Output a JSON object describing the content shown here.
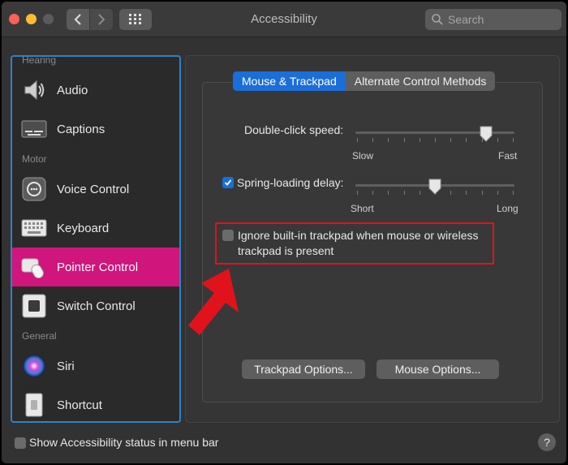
{
  "window": {
    "title": "Accessibility"
  },
  "search": {
    "placeholder": "Search"
  },
  "sidebar": {
    "sections": {
      "hearing": "Hearing",
      "motor": "Motor",
      "general": "General"
    },
    "items": [
      {
        "label": "Audio",
        "icon": "speaker-icon"
      },
      {
        "label": "Captions",
        "icon": "captions-icon"
      },
      {
        "label": "Voice Control",
        "icon": "voice-control-icon"
      },
      {
        "label": "Keyboard",
        "icon": "keyboard-icon"
      },
      {
        "label": "Pointer Control",
        "icon": "pointer-control-icon",
        "selected": true
      },
      {
        "label": "Switch Control",
        "icon": "switch-control-icon"
      },
      {
        "label": "Siri",
        "icon": "siri-icon"
      },
      {
        "label": "Shortcut",
        "icon": "shortcut-icon"
      }
    ]
  },
  "tabs": [
    {
      "label": "Mouse & Trackpad",
      "active": true
    },
    {
      "label": "Alternate Control Methods",
      "active": false
    }
  ],
  "double_click": {
    "label": "Double-click speed:",
    "min_label": "Slow",
    "max_label": "Fast",
    "value": 0.82
  },
  "spring_loading": {
    "label": "Spring-loading delay:",
    "min_label": "Short",
    "max_label": "Long",
    "checked": true,
    "value": 0.5
  },
  "ignore_trackpad": {
    "label": "Ignore built-in trackpad when mouse or wireless trackpad is present",
    "checked": false
  },
  "buttons": {
    "trackpad_options": "Trackpad Options...",
    "mouse_options": "Mouse Options..."
  },
  "bottom": {
    "status_label": "Show Accessibility status in menu bar",
    "checked": false,
    "help": "?"
  },
  "colors": {
    "accent": "#1a6ed8",
    "selected_item": "#d0157c",
    "annotation": "#e0131c",
    "sidebar_border": "#2f82c4"
  }
}
